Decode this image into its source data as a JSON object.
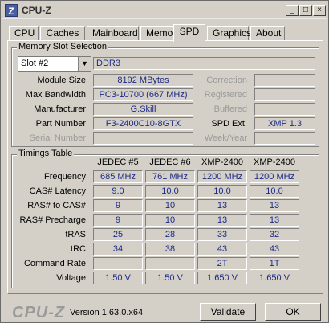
{
  "window": {
    "title": "CPU-Z",
    "logo_glyph": "Z",
    "minimize": "_",
    "maximize": "□",
    "close": "×"
  },
  "tabs": [
    {
      "label": "CPU",
      "active": false
    },
    {
      "label": "Caches",
      "active": false
    },
    {
      "label": "Mainboard",
      "active": false
    },
    {
      "label": "Memory",
      "active": false
    },
    {
      "label": "SPD",
      "active": true
    },
    {
      "label": "Graphics",
      "active": false
    },
    {
      "label": "About",
      "active": false
    }
  ],
  "memory_slot": {
    "group_title": "Memory Slot Selection",
    "slot_selected": "Slot #2",
    "memory_type": "DDR3",
    "rows": {
      "module_size": {
        "label": "Module Size",
        "value": "8192 MBytes"
      },
      "max_bandwidth": {
        "label": "Max Bandwidth",
        "value": "PC3-10700 (667 MHz)"
      },
      "manufacturer": {
        "label": "Manufacturer",
        "value": "G.Skill"
      },
      "part_number": {
        "label": "Part Number",
        "value": "F3-2400C10-8GTX"
      },
      "serial_number": {
        "label": "Serial Number",
        "value": ""
      }
    },
    "right_rows": {
      "correction": {
        "label": "Correction",
        "value": ""
      },
      "registered": {
        "label": "Registered",
        "value": ""
      },
      "buffered": {
        "label": "Buffered",
        "value": ""
      },
      "spd_ext": {
        "label": "SPD Ext.",
        "value": "XMP 1.3"
      },
      "week_year": {
        "label": "Week/Year",
        "value": ""
      }
    }
  },
  "timings": {
    "group_title": "Timings Table",
    "columns": [
      "JEDEC #5",
      "JEDEC #6",
      "XMP-2400",
      "XMP-2400"
    ],
    "rows": [
      {
        "label": "Frequency",
        "values": [
          "685 MHz",
          "761 MHz",
          "1200 MHz",
          "1200 MHz"
        ]
      },
      {
        "label": "CAS# Latency",
        "values": [
          "9.0",
          "10.0",
          "10.0",
          "10.0"
        ]
      },
      {
        "label": "RAS# to CAS#",
        "values": [
          "9",
          "10",
          "13",
          "13"
        ]
      },
      {
        "label": "RAS# Precharge",
        "values": [
          "9",
          "10",
          "13",
          "13"
        ]
      },
      {
        "label": "tRAS",
        "values": [
          "25",
          "28",
          "33",
          "32"
        ]
      },
      {
        "label": "tRC",
        "values": [
          "34",
          "38",
          "43",
          "43"
        ]
      },
      {
        "label": "Command Rate",
        "values": [
          "",
          "",
          "2T",
          "1T"
        ]
      },
      {
        "label": "Voltage",
        "values": [
          "1.50 V",
          "1.50 V",
          "1.650 V",
          "1.650 V"
        ]
      }
    ]
  },
  "footer": {
    "logo": "CPU-Z",
    "version": "Version 1.63.0.x64",
    "validate": "Validate",
    "ok": "OK"
  }
}
